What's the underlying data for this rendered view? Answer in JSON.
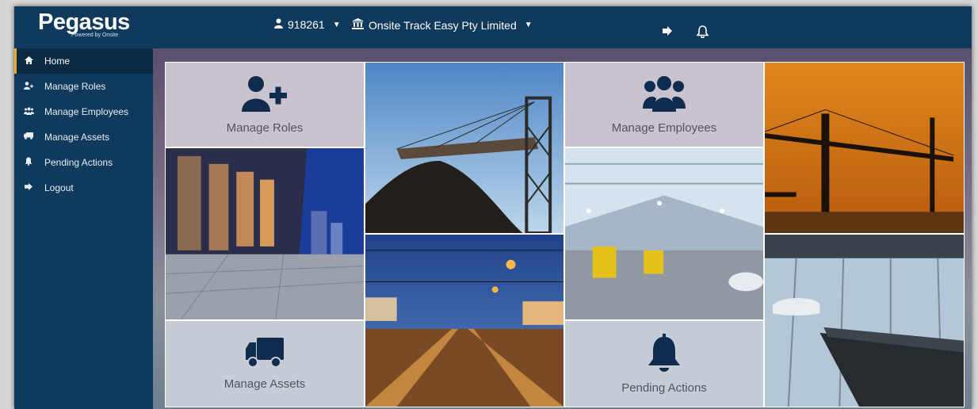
{
  "brand": {
    "name": "Pegasus",
    "tagline": "Powered by Onsite"
  },
  "header": {
    "user_id": "918261",
    "organization": "Onsite Track Easy Pty Limited",
    "icons": {
      "logout": "sign-out-icon",
      "notifications": "bell-icon"
    }
  },
  "sidebar": {
    "items": [
      {
        "label": "Home",
        "icon": "home-icon",
        "active": true
      },
      {
        "label": "Manage Roles",
        "icon": "user-plus-icon"
      },
      {
        "label": "Manage Employees",
        "icon": "users-icon"
      },
      {
        "label": "Manage Assets",
        "icon": "truck-icon"
      },
      {
        "label": "Pending Actions",
        "icon": "bell-icon"
      },
      {
        "label": "Logout",
        "icon": "sign-out-icon"
      }
    ]
  },
  "tiles": {
    "manage_roles": "Manage Roles",
    "manage_employees": "Manage Employees",
    "manage_assets": "Manage Assets",
    "pending_actions": "Pending Actions"
  },
  "colors": {
    "nav": "#0f3a5e",
    "accent": "#f5a623",
    "icon": "#0f2b4e"
  }
}
